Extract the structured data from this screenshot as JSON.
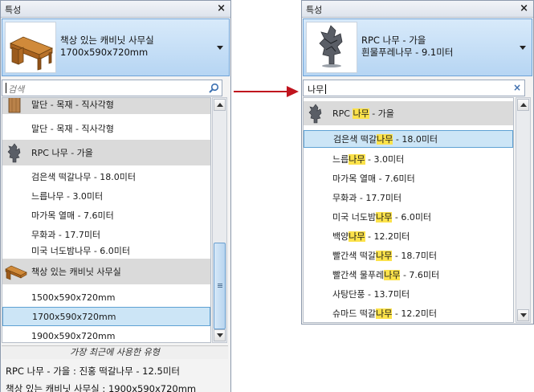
{
  "left": {
    "title": "특성",
    "close": "×",
    "type_line1": "책상 있는 캐비닛 사무실",
    "type_line2": "1700x590x720mm",
    "search_placeholder": "검색",
    "list": [
      {
        "label": "말단 - 목재 - 직사각형",
        "kind": "group"
      },
      {
        "label": "말단 - 목재 - 직사각형",
        "kind": "plain"
      },
      {
        "label": "RPC 나무 - 가을",
        "kind": "group"
      },
      {
        "label": "검은색 떡갈나무 - 18.0미터",
        "kind": "plain"
      },
      {
        "label": "느릅나무 - 3.0미터",
        "kind": "plain"
      },
      {
        "label": "마가목 열매 - 7.6미터",
        "kind": "plain"
      },
      {
        "label": "무화과 - 17.7미터",
        "kind": "plain"
      },
      {
        "label": "미국 너도밤나무 - 6.0미터",
        "kind": "plain"
      },
      {
        "label": "책상 있는 캐비닛 사무실",
        "kind": "group"
      },
      {
        "label": "1500x590x720mm",
        "kind": "plain"
      },
      {
        "label": "1700x590x720mm",
        "kind": "selected"
      },
      {
        "label": "1900x590x720mm",
        "kind": "plain"
      }
    ],
    "recent_header": "가장 최근에 사용한 유형",
    "recent": [
      "RPC 나무 - 가을 : 진홍 떡갈나무 - 12.5미터",
      "책상 있는 캐비닛 사무실 : 1900x590x720mm"
    ]
  },
  "right": {
    "title": "특성",
    "close": "×",
    "type_line1": "RPC 나무 - 가을",
    "type_line2": "흰물푸레나무 - 9.1미터",
    "search_value": "나무",
    "clear": "×",
    "list": [
      {
        "pre": "RPC ",
        "hl": "나무",
        "post": " - 가을",
        "kind": "group"
      },
      {
        "pre": "검은색 떡갈",
        "hl": "나무",
        "post": " - 18.0미터",
        "kind": "selected"
      },
      {
        "pre": "느릅",
        "hl": "나무",
        "post": " - 3.0미터",
        "kind": "plain"
      },
      {
        "pre": "마가목 열매 - 7.6미터",
        "hl": "",
        "post": "",
        "kind": "plain"
      },
      {
        "pre": "무화과 - 17.7미터",
        "hl": "",
        "post": "",
        "kind": "plain"
      },
      {
        "pre": "미국 너도밤",
        "hl": "나무",
        "post": " - 6.0미터",
        "kind": "plain"
      },
      {
        "pre": "백양",
        "hl": "나무",
        "post": " - 12.2미터",
        "kind": "plain"
      },
      {
        "pre": "빨간색 떡갈",
        "hl": "나무",
        "post": " - 18.7미터",
        "kind": "plain"
      },
      {
        "pre": "빨간색 물푸레",
        "hl": "나무",
        "post": " - 7.6미터",
        "kind": "plain"
      },
      {
        "pre": "사탕단풍 - 13.7미터",
        "hl": "",
        "post": "",
        "kind": "plain"
      },
      {
        "pre": "슈마드 떡갈",
        "hl": "나무",
        "post": " - 12.2미터",
        "kind": "plain"
      }
    ]
  },
  "colors": {
    "selection": "#cce5f6",
    "highlight": "#fce24a",
    "group_bg": "#dadada",
    "arrow": "#c0141e"
  }
}
